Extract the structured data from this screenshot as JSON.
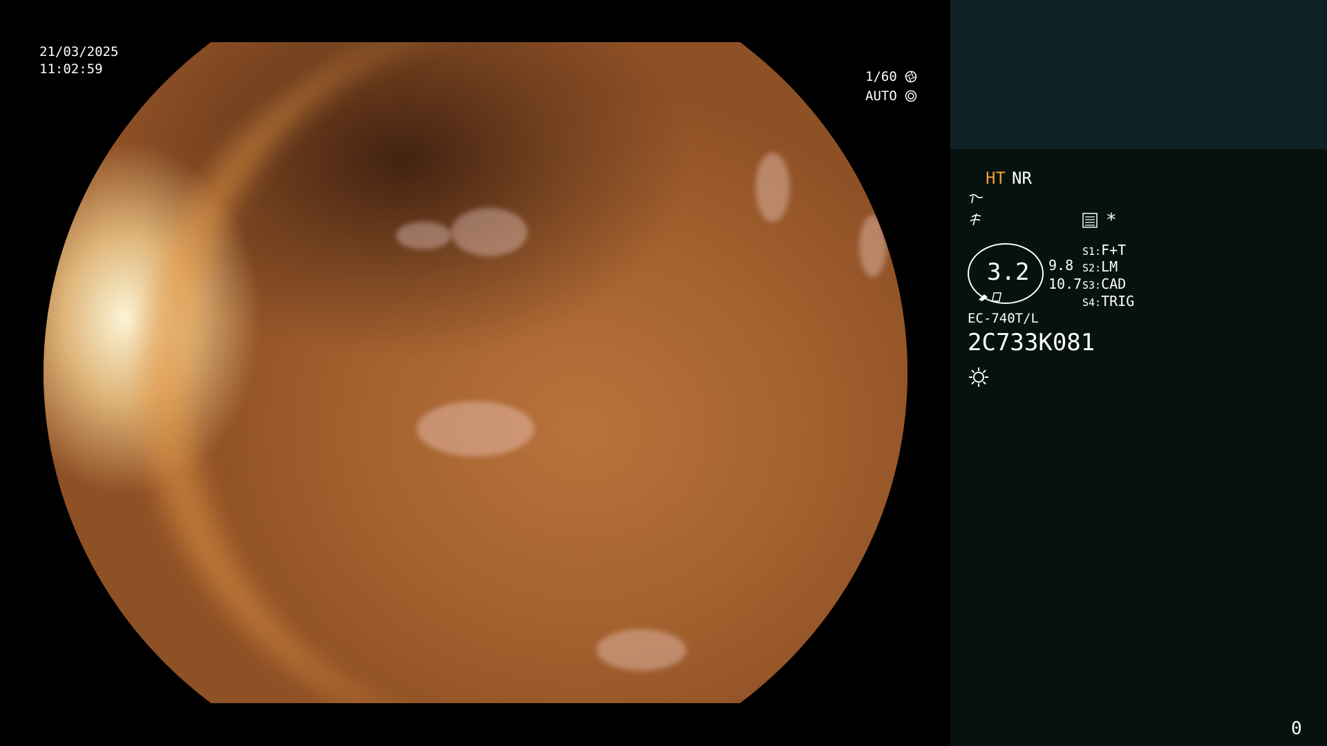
{
  "overlay": {
    "date": "21/03/2025",
    "time": "11:02:59",
    "shutter": "1/60",
    "iris": "AUTO"
  },
  "status": {
    "ht": "HT",
    "nr": "NR",
    "zoom": "3.2",
    "value_1": "9.8",
    "value_2": "10.7",
    "asterisk": "*",
    "switches": [
      {
        "label": "S1:",
        "value": "F+T"
      },
      {
        "label": "S2:",
        "value": "LM"
      },
      {
        "label": "S3:",
        "value": "CAD"
      },
      {
        "label": "S4:",
        "value": "TRIG"
      }
    ],
    "scope_model": "EC-740T/L",
    "serial": "2C733K081",
    "counter": "0"
  },
  "colors": {
    "ht": "#f0a030",
    "panel_top": "#0e2226",
    "panel_bottom": "#061210"
  },
  "icons": [
    "shutter-icon",
    "iris-icon",
    "structure-icon",
    "enhancement-icon",
    "menu-icon",
    "light-icon"
  ]
}
